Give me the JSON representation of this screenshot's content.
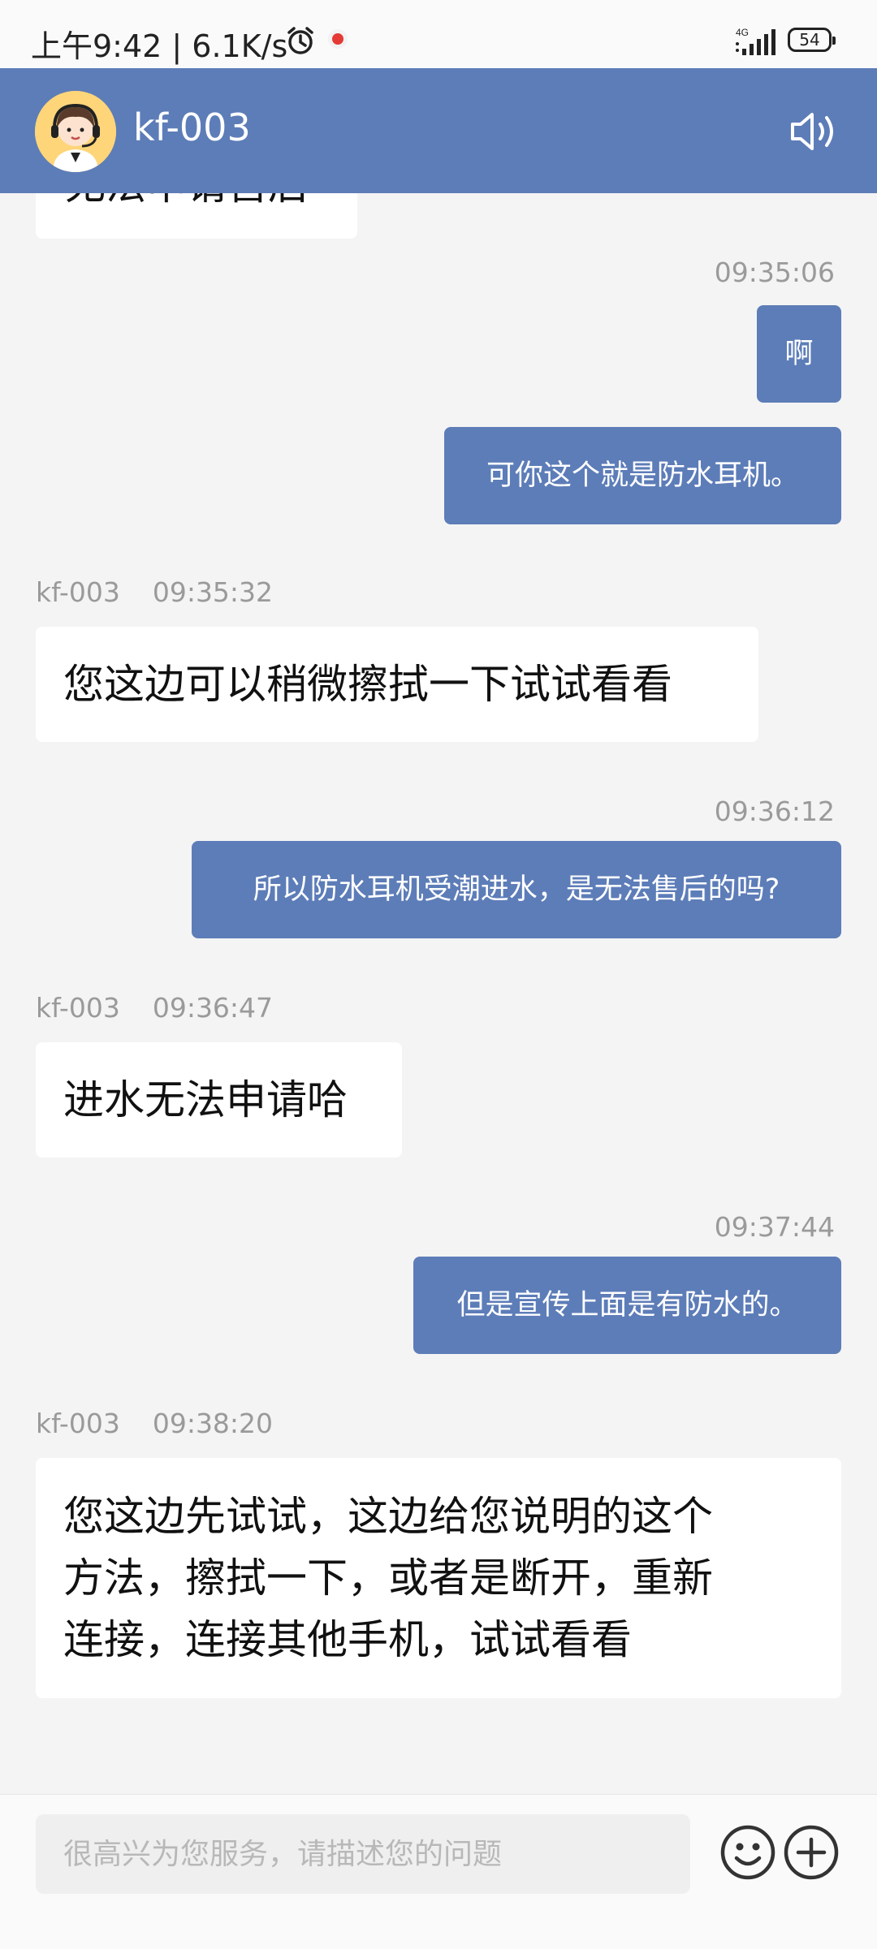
{
  "status_bar": {
    "time": "上午9:42 | 6.1K/s",
    "network": "4G",
    "battery": "54"
  },
  "header": {
    "title": "kf-003",
    "avatar_icon": "customer-service-agent-avatar",
    "speaker_icon": "speaker-icon",
    "bg_color": "#5d7db8"
  },
  "chat": {
    "partial_message": "无法申请售后",
    "messages": [
      {
        "type": "time",
        "text": "09:35:06"
      },
      {
        "type": "out",
        "text": "啊"
      },
      {
        "type": "out",
        "text": "可你这个就是防水耳机。"
      },
      {
        "type": "in",
        "sender": "kf-003",
        "time": "09:35:32",
        "text": "您这边可以稍微擦拭一下试试看看"
      },
      {
        "type": "time",
        "text": "09:36:12"
      },
      {
        "type": "out",
        "text": "所以防水耳机受潮进水，是无法售后的吗?"
      },
      {
        "type": "in",
        "sender": "kf-003",
        "time": "09:36:47",
        "text": "进水无法申请哈"
      },
      {
        "type": "time",
        "text": "09:37:44"
      },
      {
        "type": "out",
        "text": "但是宣传上面是有防水的。"
      },
      {
        "type": "in",
        "sender": "kf-003",
        "time": "09:38:20",
        "lines": [
          "您这边先试试，这边给您说明的这个",
          "方法，擦拭一下，或者是断开，重新",
          "连接，连接其他手机，试试看看"
        ]
      }
    ]
  },
  "input_bar": {
    "placeholder": "很高兴为您服务，请描述您的问题",
    "emoji_icon": "emoji-icon",
    "add_icon": "plus-circle-icon"
  }
}
